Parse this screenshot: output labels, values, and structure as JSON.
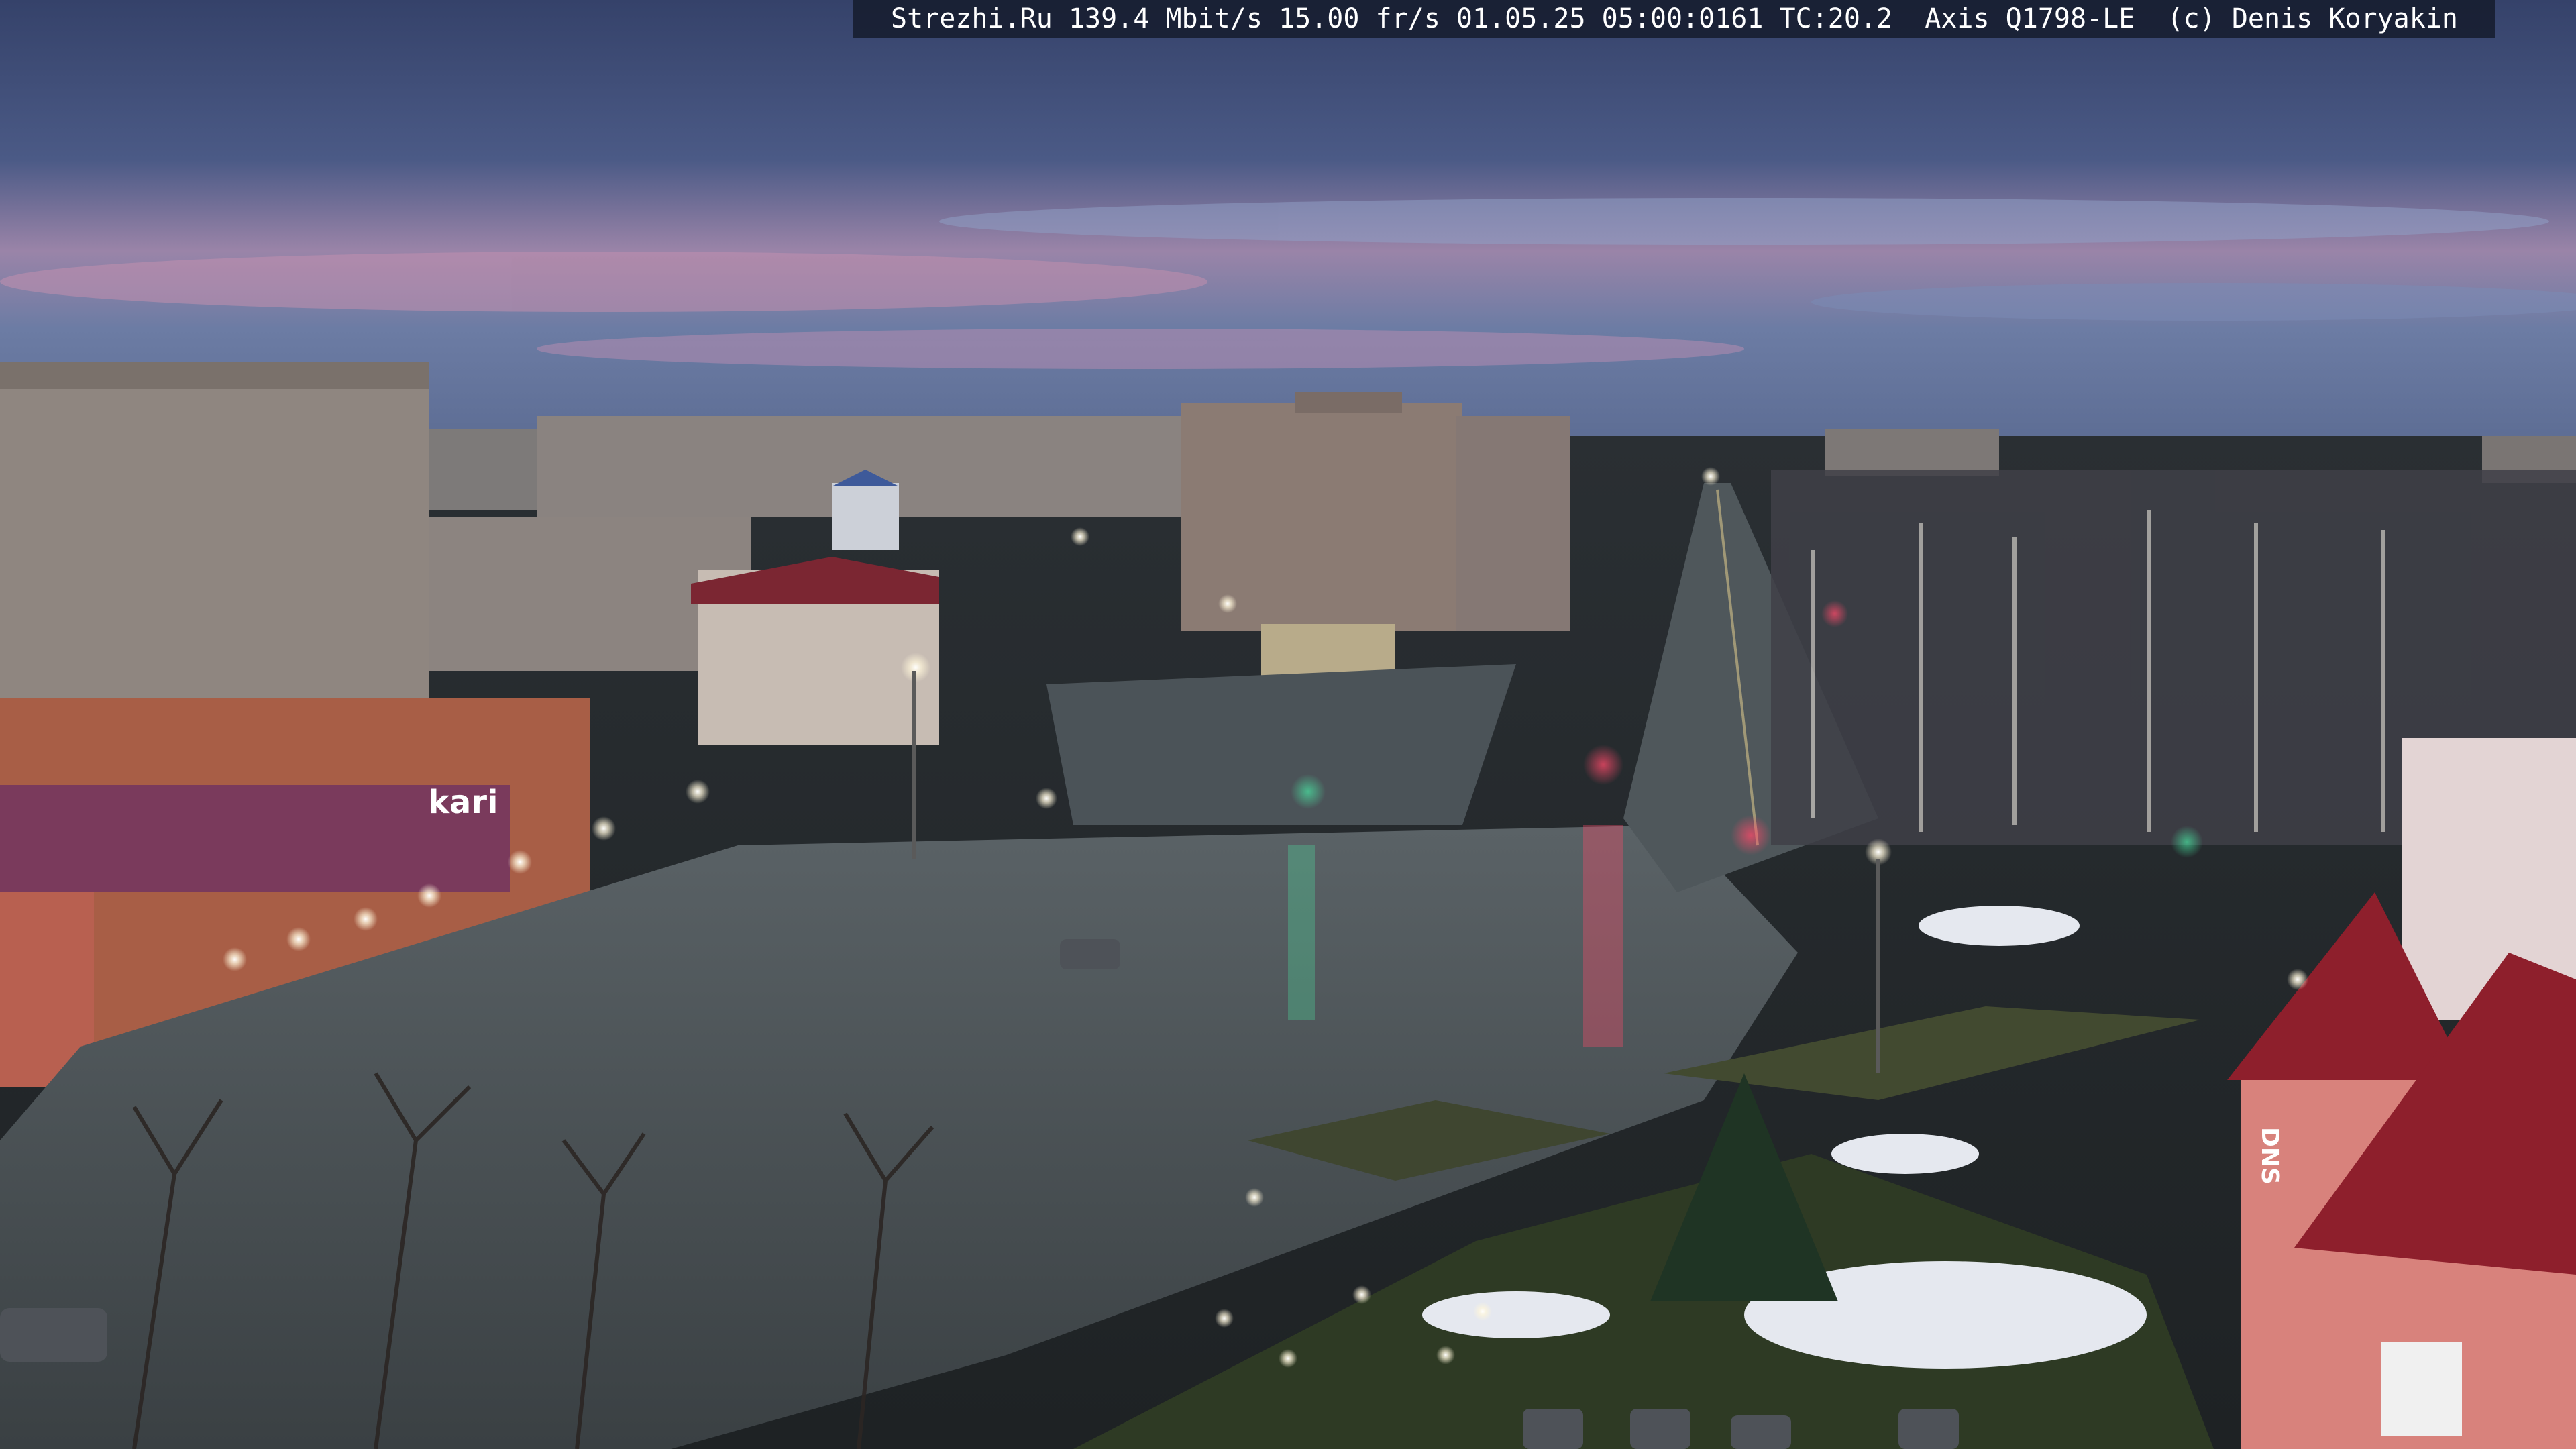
{
  "overlay": {
    "caption": "Strezhi.Ru 139.4 Mbit/s 15.00 fr/s 01.05.25 05:00:0161 TC:20.2  Axis Q1798-LE  (c) Denis Koryakin"
  },
  "signage": {
    "kari": "kari",
    "store_left": "kari",
    "dns": "DNS"
  },
  "colors": {
    "sky_top": "#3c4a72",
    "sky_pink": "#b889a8",
    "horizon": "#5e6f95",
    "asphalt": "#3d4447",
    "sign_magenta": "#b0307a",
    "roof_red": "#8e1f2c",
    "wall_pink": "#d8827c"
  }
}
